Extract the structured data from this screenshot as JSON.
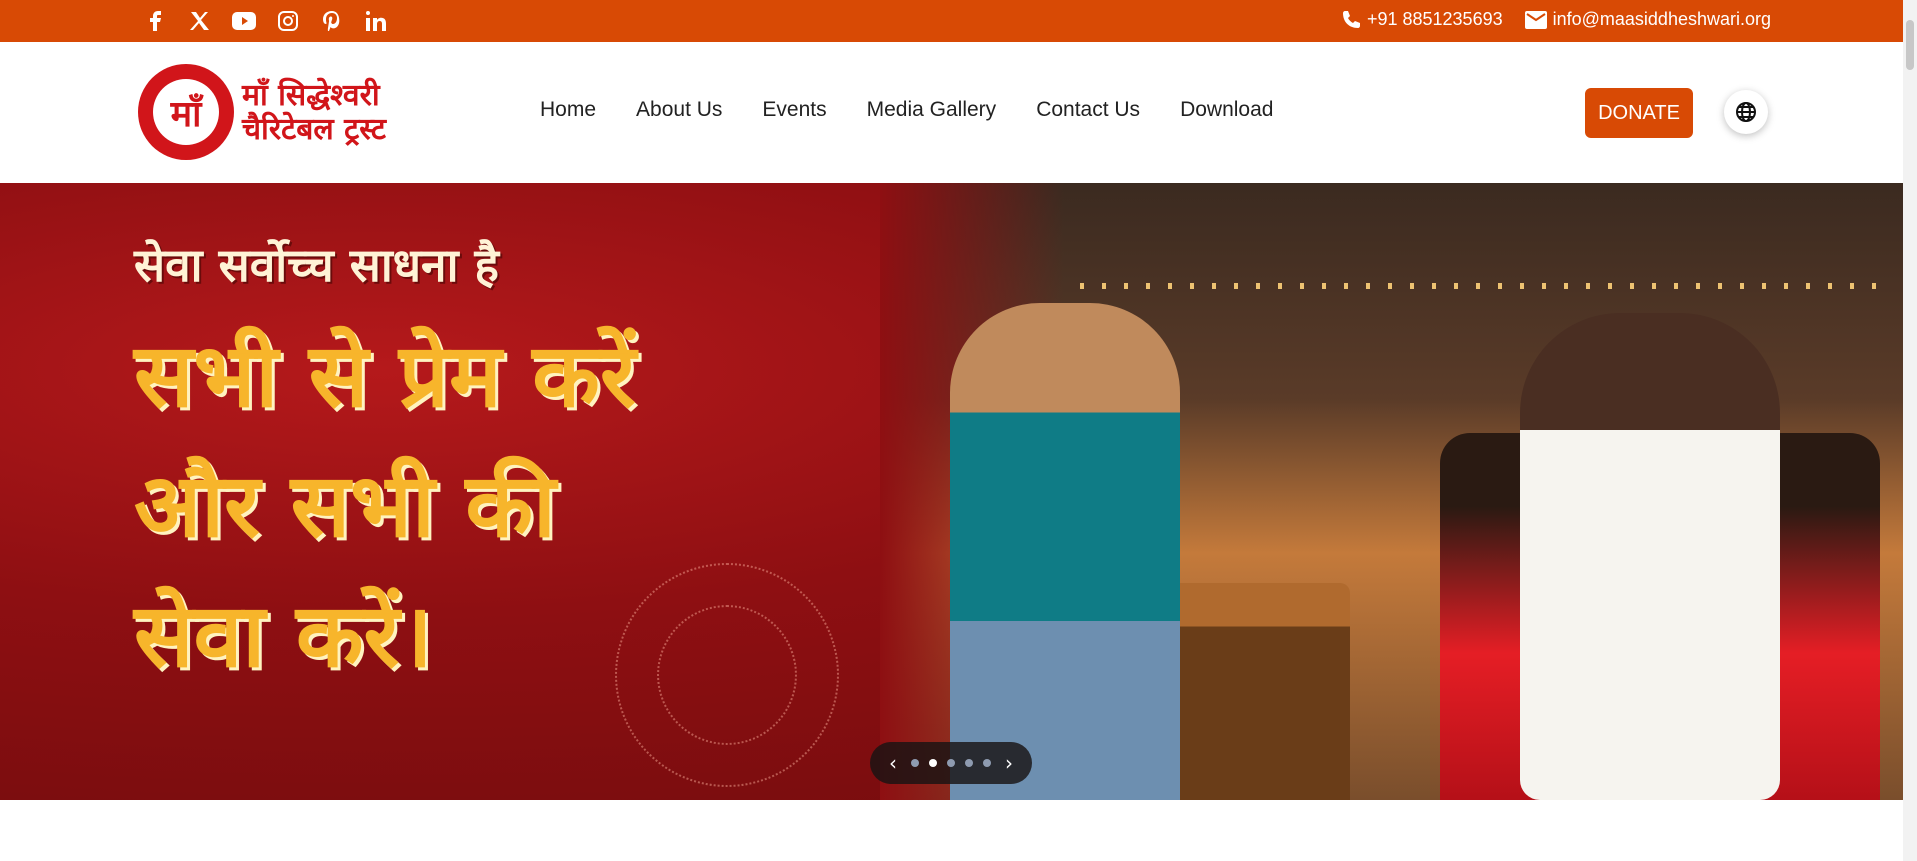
{
  "topbar": {
    "social_icons": [
      "facebook-icon",
      "x-twitter-icon",
      "youtube-icon",
      "instagram-icon",
      "pinterest-icon",
      "linkedin-icon"
    ],
    "phone": "+91 8851235693",
    "email": "info@maasiddheshwari.org"
  },
  "header": {
    "logo_text_line1": "माँ सिद्धेश्वरी",
    "logo_text_line2": "चैरिटेबल ट्रस्ट",
    "nav": [
      "Home",
      "About Us",
      "Events",
      "Media Gallery",
      "Contact Us",
      "Download"
    ],
    "donate_label": "DONATE"
  },
  "hero": {
    "tagline": "सेवा सर्वोच्च साधना है",
    "headline_line1": "सभी से प्रेम करें",
    "headline_line2": "और सभी की",
    "headline_line3": "सेवा करें।",
    "slider": {
      "slide_count": 5,
      "active_index": 1,
      "prev": "‹",
      "next": "›"
    }
  },
  "colors": {
    "accent": "#d84a05",
    "brand_red": "#d1151a",
    "headline_yellow": "#f7b52b"
  }
}
